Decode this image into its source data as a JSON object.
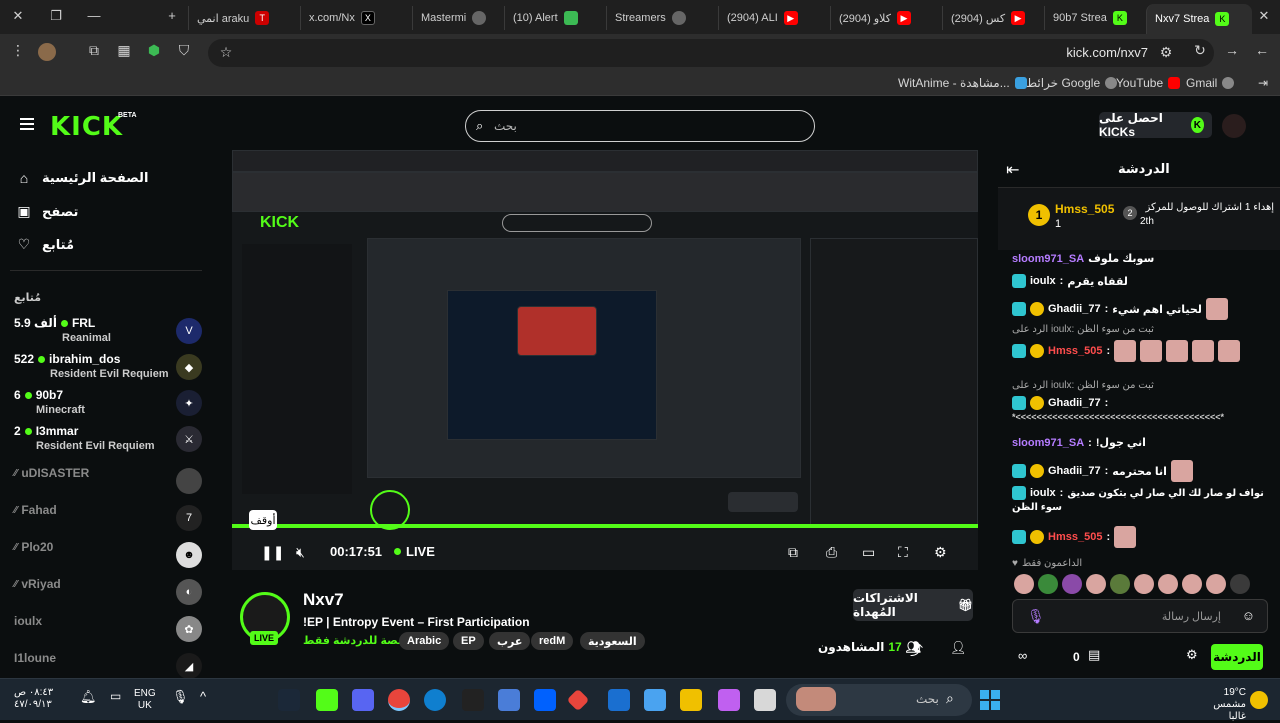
{
  "browser": {
    "tabs": [
      {
        "label": "Nxv7 Strea",
        "active": true,
        "favicon": "kick-icon"
      },
      {
        "label": "90b7 Strea",
        "favicon": "kick-icon"
      },
      {
        "label": "(2904) كس",
        "favicon": "youtube-icon"
      },
      {
        "label": "(2904) كلاو",
        "favicon": "youtube-icon"
      },
      {
        "label": "(2904) ALI",
        "favicon": "youtube-icon"
      },
      {
        "label": "Streamers",
        "favicon": "globe-icon"
      },
      {
        "label": "(10) Alert",
        "favicon": "app-icon"
      },
      {
        "label": "Mastermi",
        "favicon": "globe-icon"
      },
      {
        "label": "x.com/Nx",
        "favicon": "x-icon"
      },
      {
        "label": "انمي araku",
        "favicon": "top-icon"
      }
    ],
    "url": "kick.com/nxv7",
    "bookmarks": [
      {
        "label": "Gmail",
        "icon": "globe-icon"
      },
      {
        "label": "YouTube",
        "icon": "youtube-icon"
      },
      {
        "label": "خرائط Google",
        "icon": "globe-icon"
      },
      {
        "label": "WitAnime - مشاهدة...",
        "icon": "witanime-icon"
      }
    ]
  },
  "header": {
    "logo": "KICK",
    "beta": "BETA",
    "search_placeholder": "بحث",
    "get_kicks": "احصل على KICKs"
  },
  "sidebar": {
    "nav": [
      {
        "label": "الصفحة الرئيسية",
        "icon": "home-icon"
      },
      {
        "label": "تصفح",
        "icon": "browse-icon"
      },
      {
        "label": "مُتابع",
        "icon": "heart-icon"
      }
    ],
    "following_title": "مُتابع",
    "channels": [
      {
        "name": "FRL",
        "viewers": "5.9 ألف",
        "game": "Reanimal",
        "live": true
      },
      {
        "name": "ibrahim_dos",
        "viewers": "522",
        "game": "Resident Evil Requiem",
        "live": true
      },
      {
        "name": "90b7",
        "viewers": "6",
        "game": "Minecraft",
        "live": true
      },
      {
        "name": "I3mmar",
        "viewers": "2",
        "game": "Resident Evil Requiem",
        "live": true
      },
      {
        "name": "uDISASTER",
        "live": false
      },
      {
        "name": "Fahad",
        "live": false
      },
      {
        "name": "Plo20",
        "live": false
      },
      {
        "name": "vRiyad",
        "live": false
      },
      {
        "name": "ioulx",
        "live": false
      },
      {
        "name": "I1loune",
        "live": false
      }
    ]
  },
  "player": {
    "tooltip": "أوقف",
    "time": "00:17:51",
    "live": "LIVE"
  },
  "stream": {
    "name": "Nxv7",
    "title": "!EP | Entropy Event – First Participation",
    "category": "مخصصة للدردشة فقط",
    "tags": [
      "Arabic",
      "EP",
      "عرب",
      "redM",
      "السعودية"
    ],
    "subscribe_gift": "الاشتراكات المُهداة",
    "viewers_label": "المشاهدون",
    "viewers_count": "17",
    "live_badge": "LIVE"
  },
  "chat": {
    "title": "الدردشة",
    "pinned_user": "Hmss_505",
    "pinned_count": "1",
    "pinned_text": "إهداء 1 اشتراك للوصول للمركز",
    "pinned_rank": "2th",
    "pinned_rank_num": "2",
    "messages": [
      {
        "user": "sloom971_SA",
        "text": "سوبك ملوف",
        "color": "#b57cff"
      },
      {
        "user": "ioulx",
        "text": "لقفاه يقرم",
        "color": "#ffffff"
      },
      {
        "user": "Ghadii_77",
        "text": "لحياتي اهم شيء",
        "color": "#ffffff"
      },
      {
        "reply": "الرد على ioulx: ثبت من سوء الظن"
      },
      {
        "user": "Hmss_505",
        "text": "",
        "color": "#ff4d4d"
      },
      {
        "reply": "الرد على ioulx: ثبت من سوء الظن"
      },
      {
        "user": "Ghadii_77",
        "text": "*<<<<<<<<<<<<<<<<<<<<<<<<<<<<<<<<<<<<<<<*",
        "color": "#ffffff"
      },
      {
        "user": "sloom971_SA",
        "text": "!اني جول",
        "color": "#b57cff"
      },
      {
        "user": "Ghadii_77",
        "text": "انا محترمه",
        "color": "#ffffff"
      },
      {
        "user": "ioulx",
        "text": "نواف لو صار لك الي صار لي بتكون صديق",
        "text2": "سوء الظن",
        "color": "#ffffff"
      },
      {
        "user": "Hmss_505",
        "text": "",
        "color": "#ff4d4d"
      }
    ],
    "supporters_label": "الداعمون فقط",
    "input_placeholder": "إرسال رسالة",
    "points": "0",
    "send": "الدردشة"
  },
  "taskbar": {
    "weather_temp": "19°C",
    "weather_desc": "مشمس غالبا",
    "search": "بحث",
    "lang": "ENG",
    "lang2": "UK",
    "time": "٠٨:٤٣ ص",
    "date": "٤٧/٠٩/١٣"
  },
  "colors": {
    "accent": "#53fc18",
    "bg": "#0b0e0f"
  }
}
